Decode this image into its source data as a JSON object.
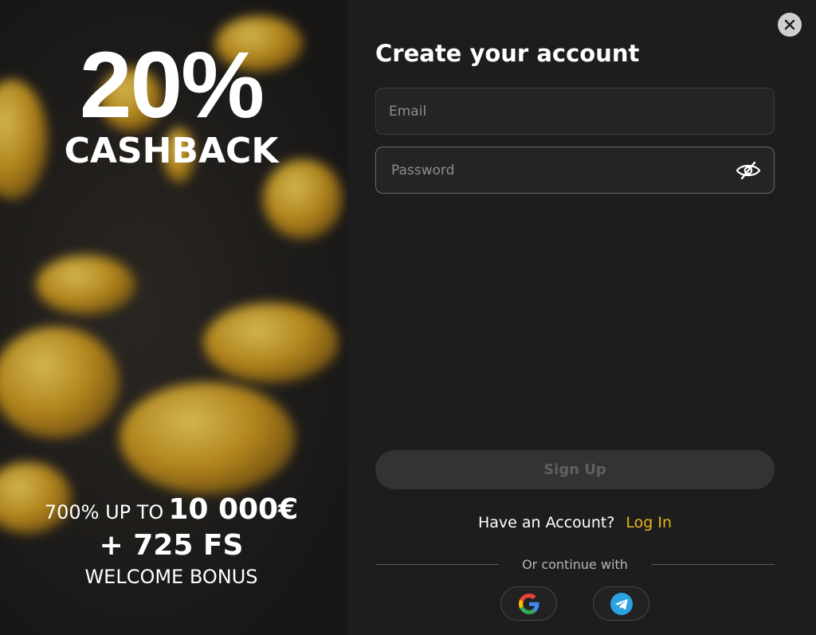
{
  "promo": {
    "headline": "20%",
    "subheadline": "CASHBACK",
    "offer_prefix": "700% UP TO",
    "offer_amount": "10 000€",
    "offer_spins": "+ 725 FS",
    "offer_caption": "WELCOME BONUS"
  },
  "form": {
    "title": "Create your account",
    "email_placeholder": "Email",
    "password_placeholder": "Password",
    "password_toggle_icon": "eye-slash-icon",
    "signup_label": "Sign Up",
    "have_account_text": "Have an Account?",
    "login_label": "Log In",
    "divider_text": "Or continue with",
    "social": [
      {
        "name": "google",
        "icon": "google-icon"
      },
      {
        "name": "telegram",
        "icon": "telegram-icon"
      }
    ],
    "close_icon": "close-icon"
  },
  "colors": {
    "accent": "#e9b51c",
    "panel_bg": "#1d1d1d",
    "button_disabled_bg": "#333333",
    "telegram_blue": "#2aa3e0"
  }
}
